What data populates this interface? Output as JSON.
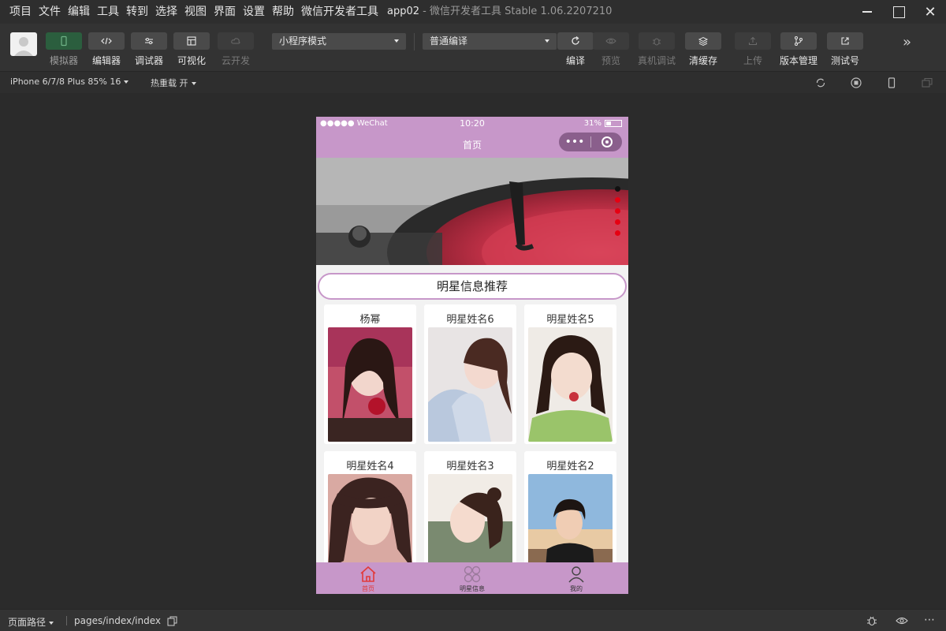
{
  "menu": [
    "项目",
    "文件",
    "编辑",
    "工具",
    "转到",
    "选择",
    "视图",
    "界面",
    "设置",
    "帮助",
    "微信开发者工具"
  ],
  "app_title": {
    "project": "app02",
    "separator": "-",
    "product": "微信开发者工具 Stable 1.06.2207210"
  },
  "toolbar": {
    "simulator": "模拟器",
    "editor": "编辑器",
    "debugger": "调试器",
    "visual": "可视化",
    "cloud": "云开发",
    "mode_select": "小程序模式",
    "compile_select": "普通编译",
    "compile": "编译",
    "preview": "预览",
    "remote_debug": "真机调试",
    "clear_cache": "清缓存",
    "upload": "上传",
    "version": "版本管理",
    "test_account": "测试号"
  },
  "subbar": {
    "device": "iPhone 6/7/8 Plus 85% 16",
    "hot_reload": "热重载 开"
  },
  "phone": {
    "status": {
      "signal": "●●●●● WeChat",
      "time": "10:20",
      "battery": "31%"
    },
    "nav_title": "首页",
    "capsule_dots": "•••",
    "section_title": "明星信息推荐",
    "cards": [
      "杨幂",
      "明星姓名6",
      "明星姓名5",
      "明星姓名4",
      "明星姓名3",
      "明星姓名2"
    ],
    "tabs": [
      "首页",
      "明星信息",
      "我的"
    ]
  },
  "bottombar": {
    "path_label": "页面路径",
    "path_value": "pages/index/index"
  },
  "colors": {
    "theme": "#c797c9",
    "active_tab": "#e23a3a",
    "dot": "#e60012"
  }
}
